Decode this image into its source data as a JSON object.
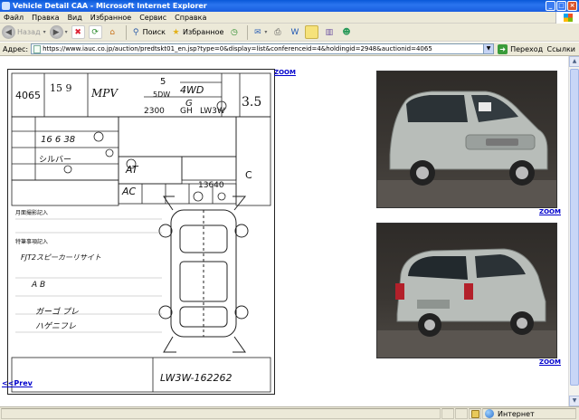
{
  "window": {
    "title": "Vehicle Detail CAA - Microsoft Internet Explorer"
  },
  "menu": [
    "Файл",
    "Правка",
    "Вид",
    "Избранное",
    "Сервис",
    "Справка"
  ],
  "toolbar": {
    "back_label": "Назад",
    "search_label": "Поиск",
    "favorites_label": "Избранное"
  },
  "address": {
    "label": "Адрес:",
    "url": "https://www.iauc.co.jp/auction/predtskt01_en.jsp?type=0&display=list&conferenceid=4&holdingid=2948&auctionid=4065",
    "go_label": "Переход",
    "links_label": "Ссылки"
  },
  "sheet": {
    "lot_number": "4065",
    "year_month": "15 9",
    "model": "MPV",
    "drive": "4WD",
    "grade": "G",
    "engine_cc": "2300",
    "code": "GH",
    "model_code": "LW3W",
    "score": "3.5",
    "doors": "5",
    "seats": "5DW",
    "transmission": "AT",
    "ac": "AC",
    "mileage": "13640",
    "color": "シルバー",
    "inspection": "16 6 38",
    "chassis": "LW3W-162262",
    "col_c": "C",
    "notes_1": "月面撮影記入",
    "notes_2": "特筆事項記入",
    "handwriting_1": "FJT2スピーカーリサイト",
    "handwriting_2": "A B",
    "handwriting_3": "ガーゴ プレ",
    "handwriting_4": "ハゲニフレ"
  },
  "content": {
    "zoom_label": "ZOOM",
    "prev_label": "<<Prev"
  },
  "status": {
    "zone_label": "Интернет"
  },
  "colors": {
    "car_body": "#b8bdb9",
    "link": "#0000cc",
    "titlebar": "#0a58d8"
  }
}
